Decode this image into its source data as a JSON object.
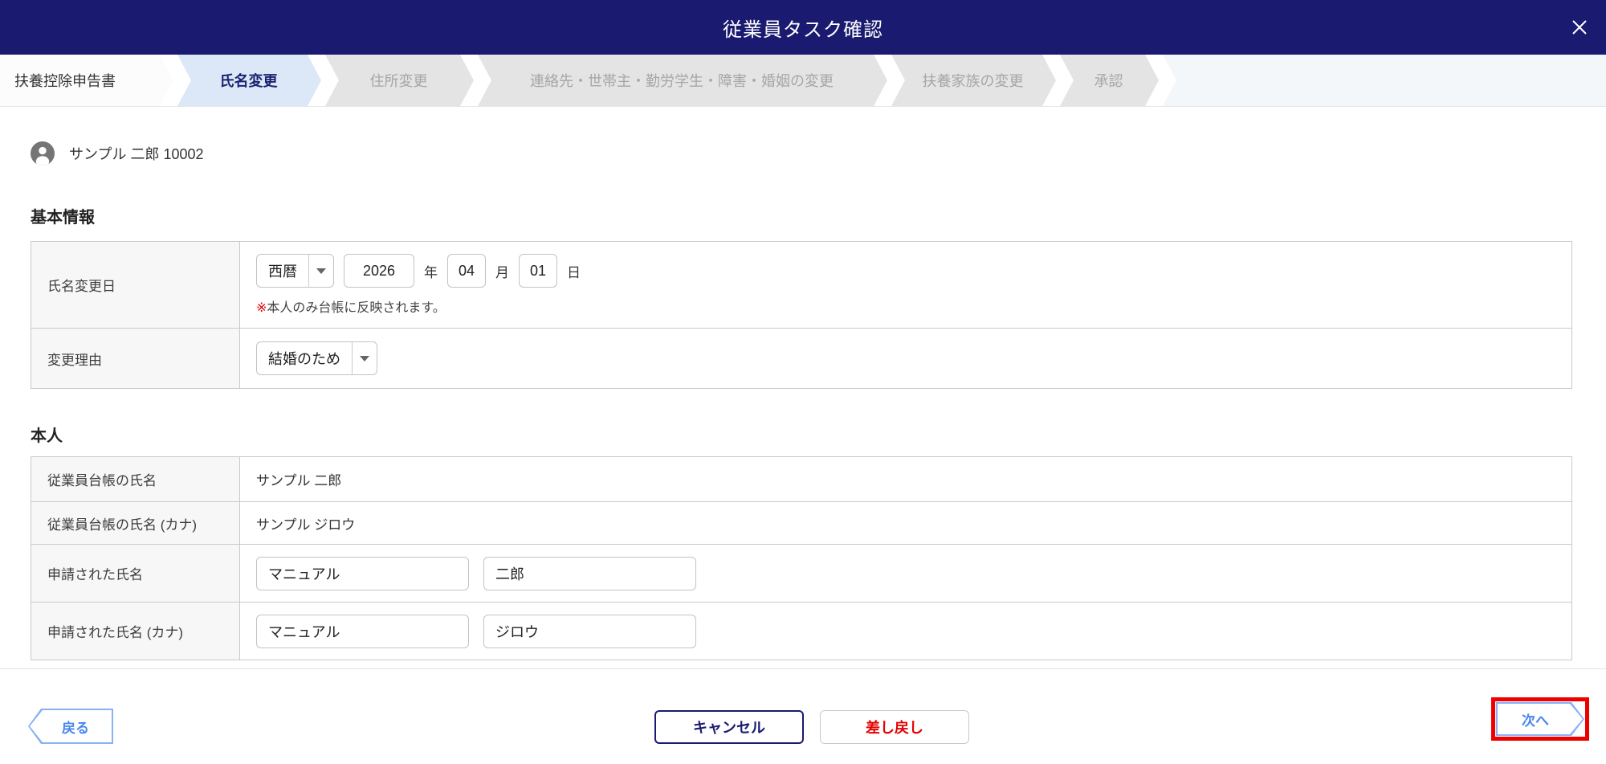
{
  "header": {
    "title": "従業員タスク確認"
  },
  "stepper": {
    "steps": [
      {
        "label": "扶養控除申告書",
        "state": "done"
      },
      {
        "label": "氏名変更",
        "state": "active"
      },
      {
        "label": "住所変更",
        "state": "upcoming"
      },
      {
        "label": "連絡先・世帯主・勤労学生・障害・婚姻の変更",
        "state": "upcoming"
      },
      {
        "label": "扶養家族の変更",
        "state": "upcoming"
      },
      {
        "label": "承認",
        "state": "upcoming"
      }
    ]
  },
  "user": {
    "display": "サンプル 二郎 10002"
  },
  "basic_info": {
    "heading": "基本情報",
    "date_row": {
      "label": "氏名変更日",
      "era": "西暦",
      "year": "2026",
      "year_unit": "年",
      "month": "04",
      "month_unit": "月",
      "day": "01",
      "day_unit": "日",
      "note_mark": "※",
      "note": "本人のみ台帳に反映されます。"
    },
    "reason_row": {
      "label": "変更理由",
      "value": "結婚のため"
    }
  },
  "person": {
    "heading": "本人",
    "rows": [
      {
        "label": "従業員台帳の氏名",
        "value": "サンプル 二郎"
      },
      {
        "label": "従業員台帳の氏名 (カナ)",
        "value": "サンプル ジロウ"
      },
      {
        "label": "申請された氏名",
        "inputs": [
          "マニュアル",
          "二郎"
        ]
      },
      {
        "label": "申請された氏名 (カナ)",
        "inputs": [
          "マニュアル",
          "ジロウ"
        ]
      }
    ]
  },
  "footer": {
    "back": "戻る",
    "cancel": "キャンセル",
    "send_back": "差し戻し",
    "next": "次へ"
  },
  "colors": {
    "header_navy": "#1a1a70",
    "active_step_bg": "#dce8f7",
    "accent_blue": "#4a86ee",
    "danger_red": "#e60000",
    "highlight_red": "#ee0000"
  }
}
